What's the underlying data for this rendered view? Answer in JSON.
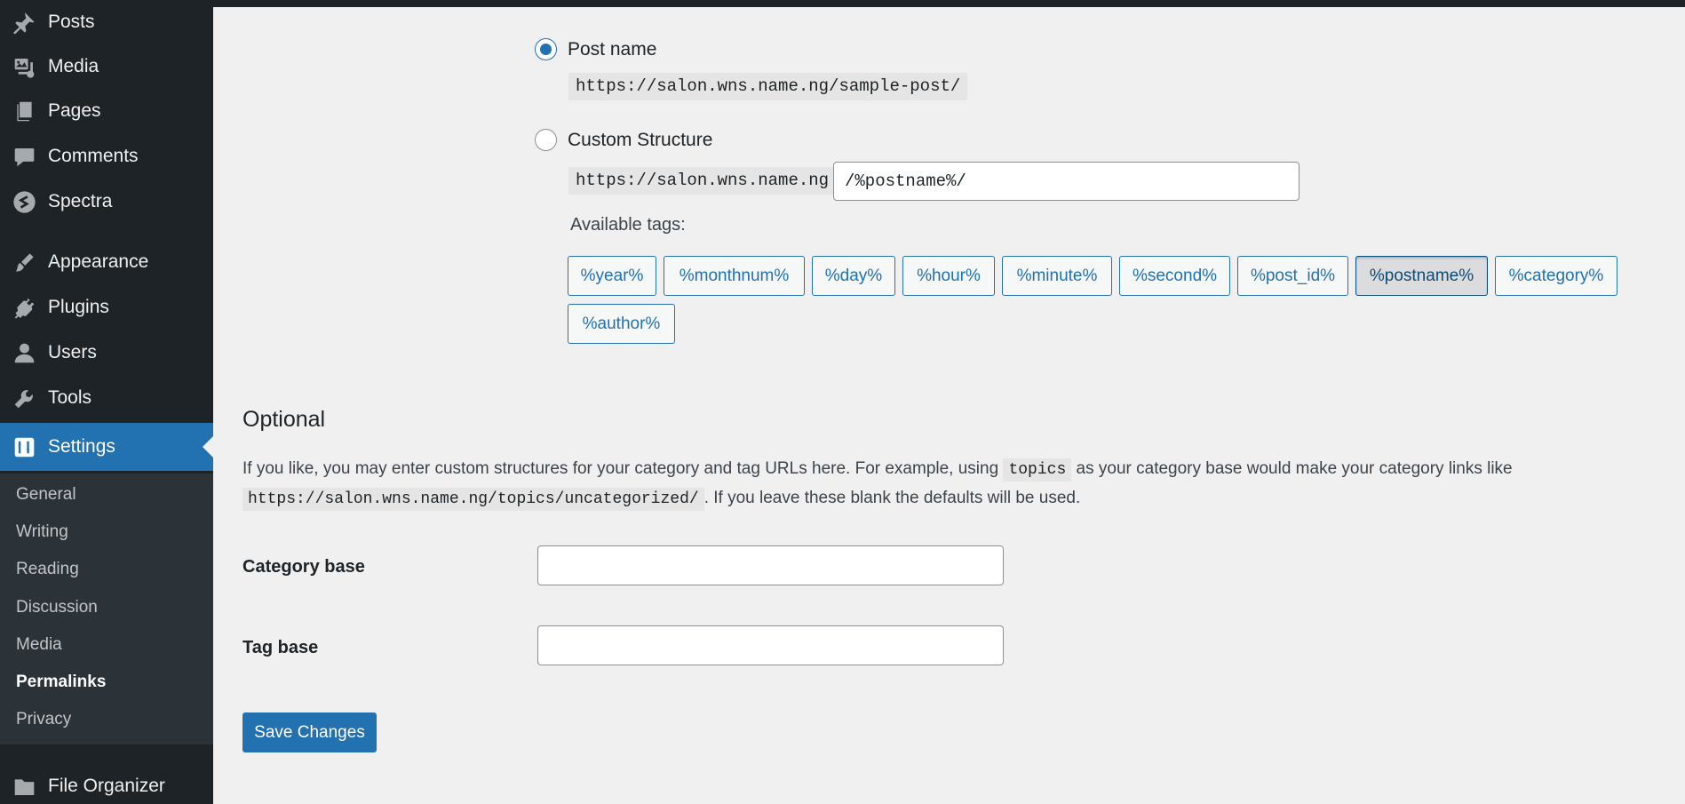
{
  "sidebar": {
    "items": [
      {
        "label": "Posts",
        "icon": "pushpin-icon"
      },
      {
        "label": "Media",
        "icon": "media-icon"
      },
      {
        "label": "Pages",
        "icon": "pages-icon"
      },
      {
        "label": "Comments",
        "icon": "comment-icon"
      },
      {
        "label": "Spectra",
        "icon": "spectra-icon"
      },
      {
        "label": "Appearance",
        "icon": "paintbrush-icon"
      },
      {
        "label": "Plugins",
        "icon": "plugin-icon"
      },
      {
        "label": "Users",
        "icon": "user-icon"
      },
      {
        "label": "Tools",
        "icon": "wrench-icon"
      },
      {
        "label": "Settings",
        "icon": "settings-sliders-icon",
        "active": true
      },
      {
        "label": "File Organizer",
        "icon": "folder-icon"
      }
    ],
    "submenu": [
      "General",
      "Writing",
      "Reading",
      "Discussion",
      "Media",
      "Permalinks",
      "Privacy"
    ],
    "current_submenu": "Permalinks",
    "accent_color": "#2271b1"
  },
  "permalink": {
    "post_name_label": "Post name",
    "post_name_example": "https://salon.wns.name.ng/sample-post/",
    "post_name_selected": true,
    "custom_label": "Custom Structure",
    "custom_prefix": "https://salon.wns.name.ng",
    "custom_value": "/%postname%/",
    "available_tags_label": "Available tags:",
    "tags": [
      "%year%",
      "%monthnum%",
      "%day%",
      "%hour%",
      "%minute%",
      "%second%",
      "%post_id%",
      "%postname%",
      "%category%",
      "%author%"
    ],
    "pressed_tag": "%postname%"
  },
  "optional": {
    "heading": "Optional",
    "text_before": "If you like, you may enter custom structures for your category and tag URLs here. For example, using ",
    "example_code": "topics",
    "text_middle": " as your category base would make your category links like ",
    "example_url": "https://salon.wns.name.ng/topics/uncategorized/",
    "text_after": ". If you leave these blank the defaults will be used.",
    "category_base_label": "Category base",
    "category_base_value": "",
    "tag_base_label": "Tag base",
    "tag_base_value": ""
  },
  "save_button_label": "Save Changes"
}
